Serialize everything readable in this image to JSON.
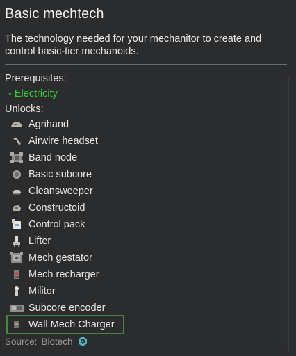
{
  "research": {
    "title": "Basic mechtech",
    "description": "The technology needed for your mechanitor to create and control basic-tier mechanoids.",
    "prerequisites_label": "Prerequisites:",
    "prerequisites": [
      "- Electricity"
    ],
    "unlocks_label": "Unlocks:",
    "unlocks": [
      {
        "label": "Agrihand",
        "icon": "agrihand-icon"
      },
      {
        "label": "Airwire headset",
        "icon": "airwire-headset-icon"
      },
      {
        "label": "Band node",
        "icon": "band-node-icon"
      },
      {
        "label": "Basic subcore",
        "icon": "basic-subcore-icon"
      },
      {
        "label": "Cleansweeper",
        "icon": "cleansweeper-icon"
      },
      {
        "label": "Constructoid",
        "icon": "constructoid-icon"
      },
      {
        "label": "Control pack",
        "icon": "control-pack-icon"
      },
      {
        "label": "Lifter",
        "icon": "lifter-icon"
      },
      {
        "label": "Mech gestator",
        "icon": "mech-gestator-icon"
      },
      {
        "label": "Mech recharger",
        "icon": "mech-recharger-icon"
      },
      {
        "label": "Militor",
        "icon": "militor-icon"
      },
      {
        "label": "Subcore encoder",
        "icon": "subcore-encoder-icon"
      },
      {
        "label": "Wall Mech Charger",
        "icon": "wall-mech-charger-icon",
        "highlighted": true
      }
    ],
    "source_label": "Source:",
    "source_value": "Biotech",
    "source_icon": "biotech-icon"
  },
  "colors": {
    "background": "#2b2c2e",
    "prerequisite_met": "#35d135",
    "highlight_border": "#3f8a3f",
    "source_icon": "#4fb8c8"
  }
}
